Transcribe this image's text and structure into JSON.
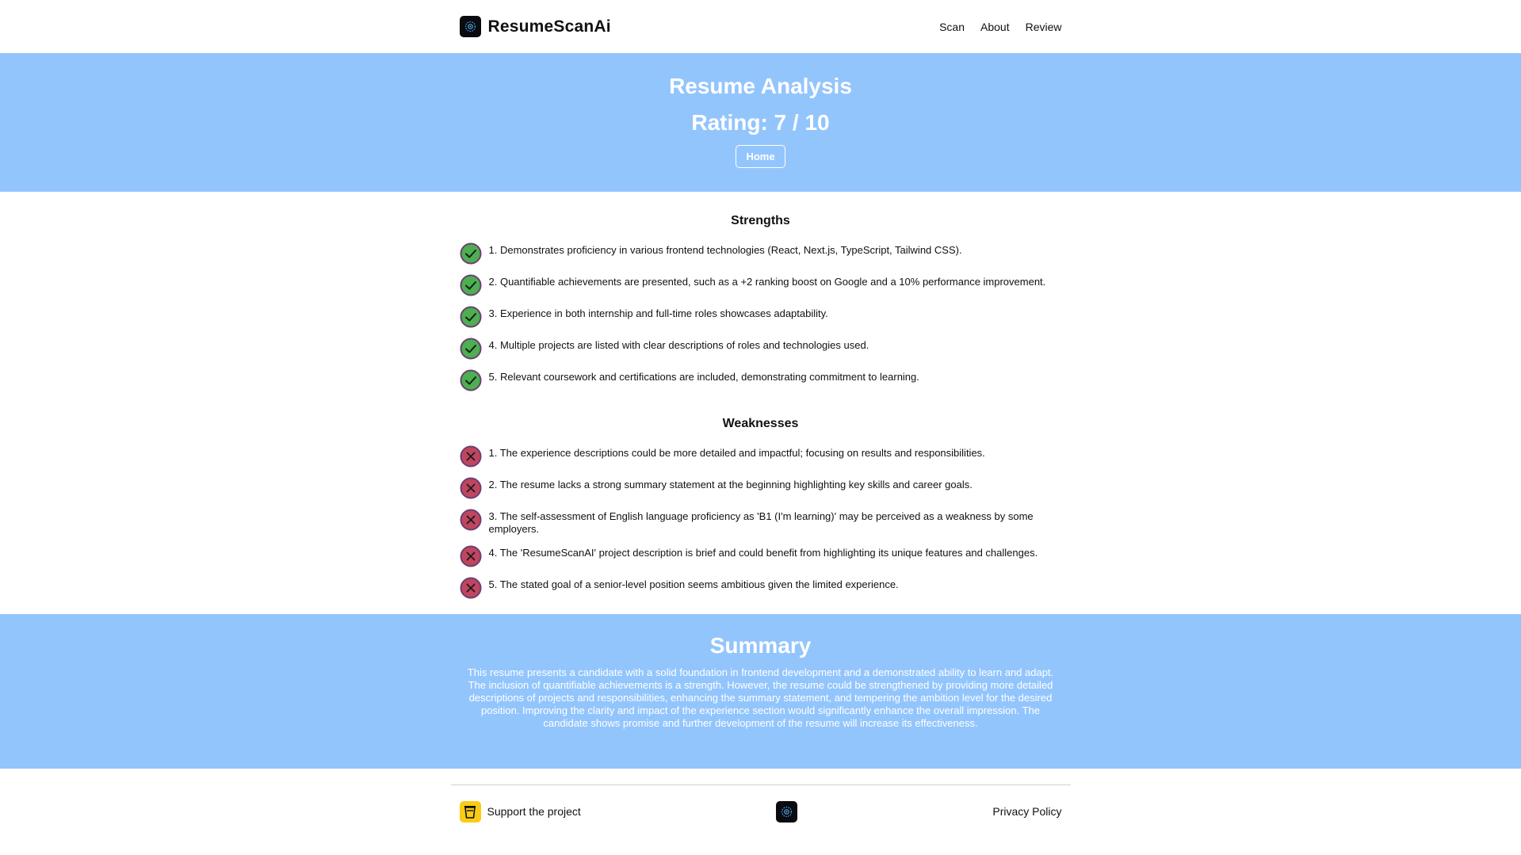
{
  "header": {
    "brand": "ResumeScanAi",
    "nav": [
      "Scan",
      "About",
      "Review"
    ]
  },
  "hero": {
    "title": "Resume Analysis",
    "rating": "Rating: 7 / 10",
    "home_label": "Home"
  },
  "strengths": {
    "title": "Strengths",
    "items": [
      "1. Demonstrates proficiency in various frontend technologies (React, Next.js, TypeScript, Tailwind CSS).",
      "2. Quantifiable achievements are presented, such as a +2 ranking boost on Google and a 10% performance improvement.",
      "3. Experience in both internship and full-time roles showcases adaptability.",
      "4. Multiple projects are listed with clear descriptions of roles and technologies used.",
      "5. Relevant coursework and certifications are included, demonstrating commitment to learning."
    ]
  },
  "weaknesses": {
    "title": "Weaknesses",
    "items": [
      "1. The experience descriptions could be more detailed and impactful; focusing on results and responsibilities.",
      "2. The resume lacks a strong summary statement at the beginning highlighting key skills and career goals.",
      "3. The self-assessment of English language proficiency as 'B1 (I'm learning)' may be perceived as a weakness by some employers.",
      "4. The 'ResumeScanAI' project description is brief and could benefit from highlighting its unique features and challenges.",
      "5. The stated goal of a senior-level position seems ambitious given the limited experience."
    ]
  },
  "summary": {
    "title": "Summary",
    "text": "This resume presents a candidate with a solid foundation in frontend development and a demonstrated ability to learn and adapt. The inclusion of quantifiable achievements is a strength. However, the resume could be strengthened by providing more detailed descriptions of projects and responsibilities, enhancing the summary statement, and tempering the ambition level for the desired position. Improving the clarity and impact of the experience section would significantly enhance the overall impression. The candidate shows promise and further development of the resume will increase its effectiveness."
  },
  "footer": {
    "support_label": "Support the project",
    "privacy_label": "Privacy Policy"
  },
  "colors": {
    "hero_bg": "#93c5fd",
    "check_green": "#4caf50",
    "cross_red": "#c0455e",
    "icon_border": "#6b3f73",
    "cup_yellow": "#facc15"
  },
  "icons": {
    "logo": "brain-scan-icon",
    "strength": "check-circle-icon",
    "weakness": "x-circle-icon",
    "support": "coffee-cup-icon"
  }
}
